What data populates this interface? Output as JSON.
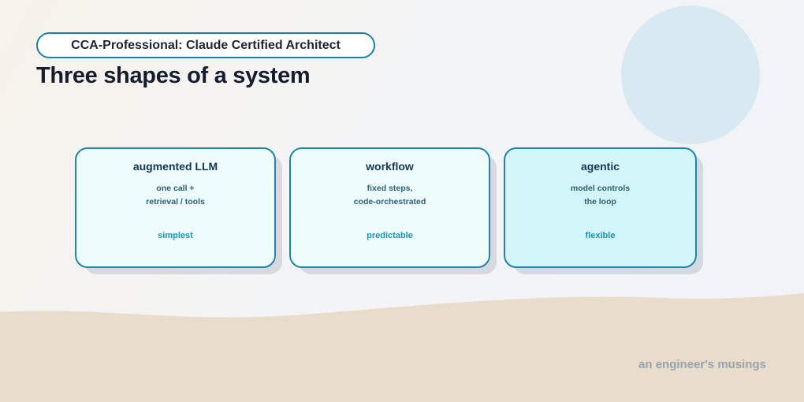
{
  "header": {
    "badge": "CCA-Professional: Claude Certified Architect",
    "title": "Three shapes of a system"
  },
  "cards": [
    {
      "title": "augmented LLM",
      "desc_line1": "one call +",
      "desc_line2": "retrieval / tools",
      "trait": "simplest"
    },
    {
      "title": "workflow",
      "desc_line1": "fixed steps,",
      "desc_line2": "code-orchestrated",
      "trait": "predictable"
    },
    {
      "title": "agentic",
      "desc_line1": "model controls",
      "desc_line2": "the loop",
      "trait": "flexible"
    }
  ],
  "footer": {
    "text": "an engineer's musings"
  },
  "colors": {
    "accent": "#1f84a8",
    "card_fill": "#eefcfe",
    "card_fill_highlight": "#d3f6fb",
    "trait_text": "#1a92b3",
    "sand": "#e8dccb",
    "bubble": "#d8e9f1"
  }
}
